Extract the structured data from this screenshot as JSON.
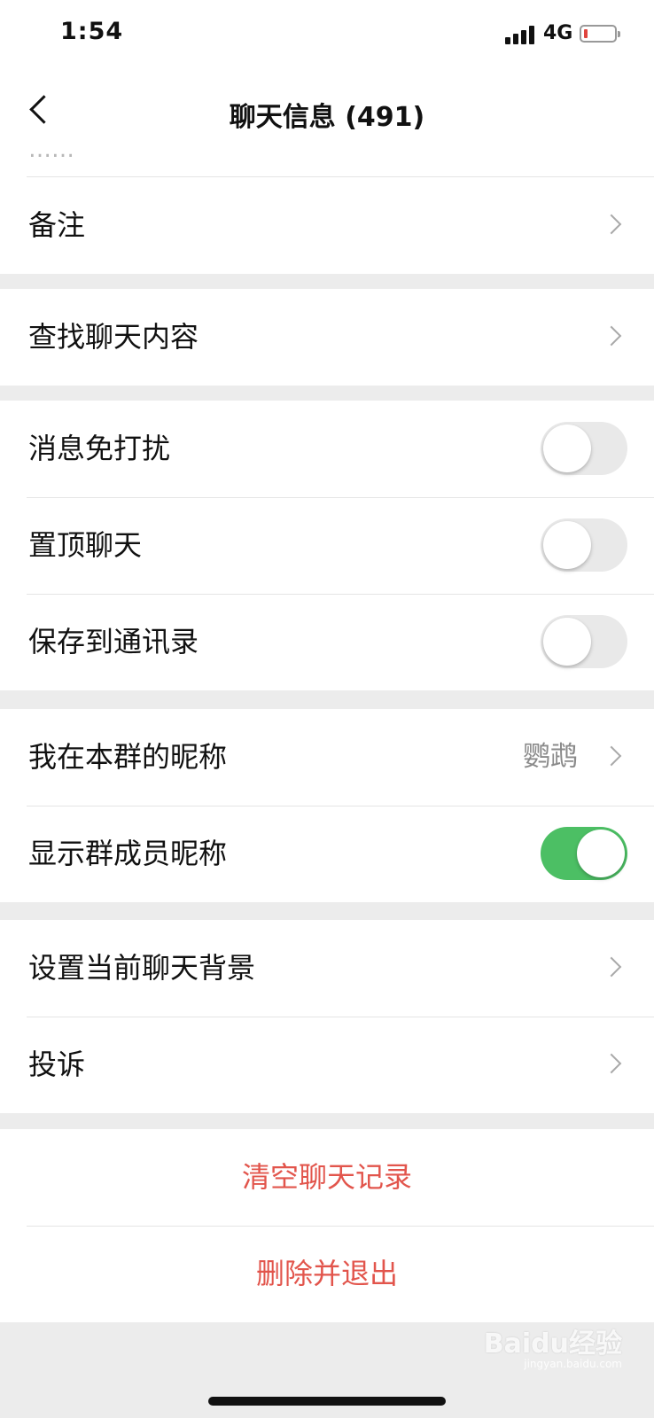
{
  "status_bar": {
    "time": "1:54",
    "network": "4G"
  },
  "nav": {
    "title": "聊天信息 (491)"
  },
  "partial_row": {
    "text": "……"
  },
  "sections": {
    "remark": {
      "label": "备注"
    },
    "search": {
      "label": "查找聊天内容"
    },
    "mute": {
      "label": "消息免打扰",
      "enabled": false
    },
    "sticky": {
      "label": "置顶聊天",
      "enabled": false
    },
    "save_contacts": {
      "label": "保存到通讯录",
      "enabled": false
    },
    "my_nickname": {
      "label": "我在本群的昵称",
      "value": "鹦鹉"
    },
    "show_nicknames": {
      "label": "显示群成员昵称",
      "enabled": true
    },
    "background": {
      "label": "设置当前聊天背景"
    },
    "complain": {
      "label": "投诉"
    },
    "clear_history": {
      "label": "清空聊天记录"
    },
    "delete_exit": {
      "label": "删除并退出"
    }
  },
  "watermark": {
    "brand": "Baidu经验",
    "domain": "jingyan.baidu.com"
  },
  "colors": {
    "toggle_on": "#4cbf64",
    "danger_text": "#e2554c",
    "background": "#ececec"
  }
}
